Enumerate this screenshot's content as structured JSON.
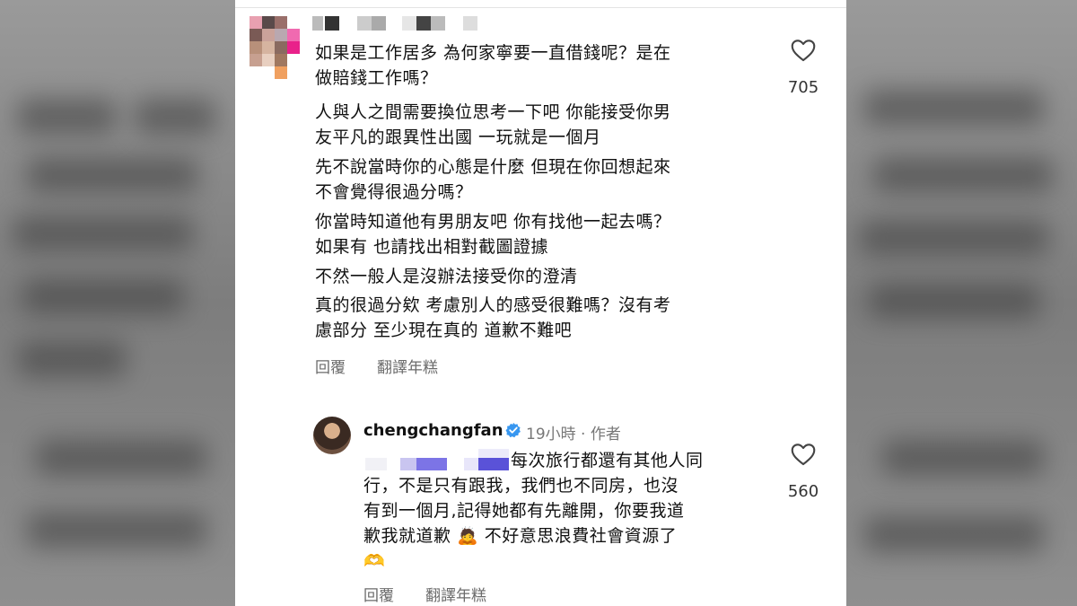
{
  "comment1": {
    "lines": [
      "如果是工作居多 為何家寧要一直借錢呢？是在",
      "做賠錢工作嗎？",
      "人與人之間需要換位思考一下吧 你能接受你男",
      "友平凡的跟異性出國 一玩就是一個月",
      "先不說當時你的心態是什麼 但現在你回想起來",
      "不會覺得很過分嗎？",
      "你當時知道他有男朋友吧 你有找他一起去嗎？",
      "如果有 也請找出相對截圖證據",
      "不然一般人是沒辦法接受你的澄清",
      "真的很過分欸 考慮別人的感受很難嗎？沒有考",
      "慮部分 至少現在真的 道歉不難吧"
    ],
    "likes": "705",
    "reply_label": "回覆",
    "translate_label": "翻譯年糕"
  },
  "reply": {
    "username": "chengchangfan",
    "time": "19小時",
    "separator": "·",
    "author_tag": "作者",
    "line1": "每次旅行都還有其他人同",
    "line2": "行，不是只有跟我，我們也不同房，也沒",
    "line3": "有到一個月,記得她都有先離開，你要我道",
    "line4_pre": "歉我就道歉",
    "emoji1": "🙇",
    "line4_post": "不好意思浪費社會資源了",
    "emoji2": "🫶",
    "likes": "560",
    "reply_label": "回覆",
    "translate_label": "翻譯年糕"
  },
  "icons": {
    "heart": "heart-icon",
    "verified": "verified-badge-icon"
  },
  "colors": {
    "verified_blue": "#3897f0",
    "text": "#111111",
    "secondary": "#6b6b6b"
  }
}
